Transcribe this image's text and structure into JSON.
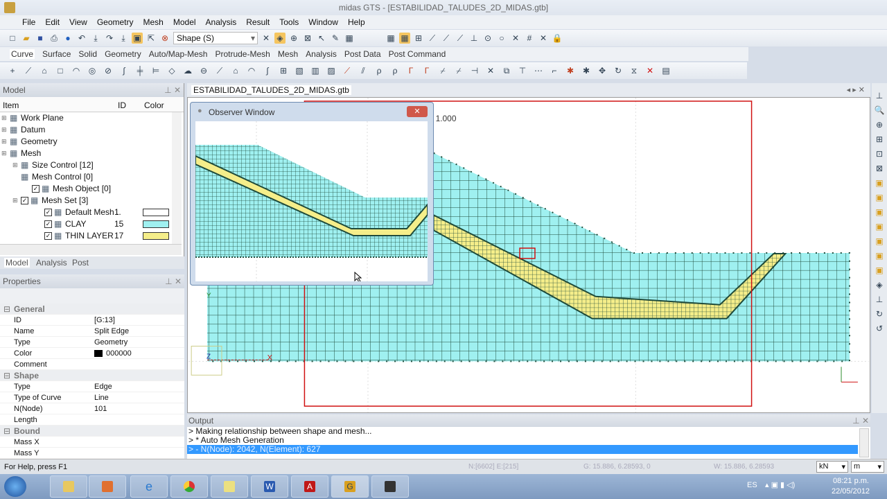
{
  "window": {
    "title": "midas GTS - [ESTABILIDAD_TALUDES_2D_MIDAS.gtb]"
  },
  "menu": [
    "File",
    "Edit",
    "View",
    "Geometry",
    "Mesh",
    "Model",
    "Analysis",
    "Result",
    "Tools",
    "Window",
    "Help"
  ],
  "toolbar": {
    "select_filter": "Shape (S)"
  },
  "ribbon_tabs": [
    "Curve",
    "Surface",
    "Solid",
    "Geometry",
    "Auto/Map-Mesh",
    "Protrude-Mesh",
    "Mesh",
    "Analysis",
    "Post Data",
    "Post Command"
  ],
  "model_panel": {
    "title": "Model",
    "columns": [
      "Item",
      "ID",
      "Color"
    ],
    "items": [
      {
        "label": "Work Plane",
        "id": "",
        "color": ""
      },
      {
        "label": "Datum",
        "id": "",
        "color": ""
      },
      {
        "label": "Geometry",
        "id": "",
        "color": ""
      },
      {
        "label": "Mesh",
        "id": "",
        "color": ""
      },
      {
        "label": "Size Control [12]",
        "id": "",
        "color": ""
      },
      {
        "label": "Mesh Control [0]",
        "id": "",
        "color": ""
      },
      {
        "label": "Mesh Object [0]",
        "id": "",
        "color": ""
      },
      {
        "label": "Mesh Set [3]",
        "id": "",
        "color": ""
      },
      {
        "label": "Default Mesh ..",
        "id": "1",
        "color": "#ffffff"
      },
      {
        "label": "CLAY",
        "id": "15",
        "color": "#9ff0f0"
      },
      {
        "label": "THIN LAYER",
        "id": "17",
        "color": "#f5ee8a"
      }
    ],
    "tabs": [
      "Model",
      "Analysis",
      "Post"
    ]
  },
  "properties": {
    "title": "Properties",
    "sections": [
      {
        "name": "General",
        "rows": [
          [
            "ID",
            "[G:13]"
          ],
          [
            "Name",
            "Split Edge"
          ],
          [
            "Type",
            "Geometry"
          ],
          [
            "Color",
            "000000"
          ],
          [
            "Comment",
            ""
          ]
        ]
      },
      {
        "name": "Shape",
        "rows": [
          [
            "Type",
            "Edge"
          ],
          [
            "Type of Curve",
            "Line"
          ],
          [
            "N(Node)",
            "101"
          ],
          [
            "Length",
            ""
          ]
        ]
      },
      {
        "name": "Bound",
        "rows": [
          [
            "Mass X",
            ""
          ],
          [
            "Mass Y",
            ""
          ]
        ]
      }
    ]
  },
  "document": {
    "tab": "ESTABILIDAD_TALUDES_2D_MIDAS.gtb",
    "scale_label": "1.000",
    "axis_x": "X",
    "axis_y": "Y",
    "axis_z": "Z"
  },
  "observer": {
    "title": "Observer Window"
  },
  "colors": {
    "clay": "#9ff0f0",
    "thin_layer": "#f5ee8a",
    "mesh_line": "#1e4a3a",
    "boundary": "#d01010",
    "highlight": "#3399ff"
  },
  "output": {
    "title": "Output",
    "lines": [
      "> Making relationship between shape and mesh...",
      "> * Auto Mesh Generation",
      "> - N(Node): 2042, N(Element): 627"
    ]
  },
  "status": {
    "help": "For Help, press F1",
    "node_elem": "N:[6602] E:[215]",
    "global": "G: 15.886, 6.28593, 0",
    "work": "W: 15.886, 6.28593",
    "force_unit": "kN",
    "length_unit": "m"
  },
  "taskbar": {
    "language": "ES",
    "time": "08:21 p.m.",
    "date": "22/05/2012"
  }
}
